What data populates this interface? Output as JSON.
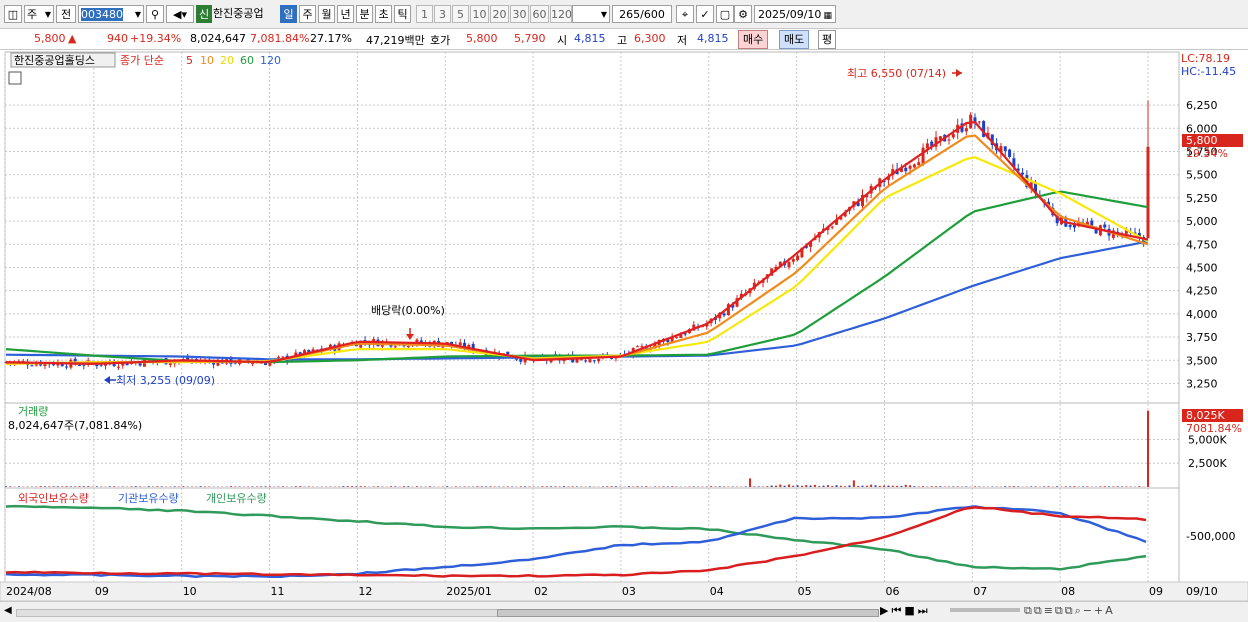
{
  "toolbar": {
    "market": "주",
    "prev": "전",
    "code": "003480",
    "new_badge": "신",
    "name": "한진중공업",
    "periods": [
      "일",
      "주",
      "월",
      "년",
      "분",
      "초",
      "틱"
    ],
    "period_active": "일",
    "intervals": [
      "1",
      "3",
      "5",
      "10",
      "20",
      "30",
      "60",
      "120"
    ],
    "count_value": "265",
    "count_total": "/600",
    "date": "2025/09/10"
  },
  "quote": {
    "price": "5,800",
    "up_arrow": "▲",
    "change": "940",
    "change_pct": "+19.34%",
    "volume": "8,024,647",
    "volume_ratio": "7,081.84%",
    "turnover": "27.17%",
    "amount": "47,219백만",
    "ask_label": "호가",
    "ask": "5,800",
    "bid": "5,790",
    "open_label": "시",
    "open": "4,815",
    "high_label": "고",
    "high": "6,300",
    "low_label": "저",
    "low": "4,815",
    "buy_label": "매수",
    "sell_label": "매도",
    "avg_label": "평"
  },
  "colors": {
    "up": "#d9261c",
    "down": "#1e40c8",
    "ma5": "#e02020",
    "ma10": "#f08a1c",
    "ma20": "#f7e80a",
    "ma60": "#1e9e3a",
    "ma120": "#2f5fd8",
    "foreign": "#d81e1e",
    "institution": "#2f5fd8",
    "individual": "#2f9a5a"
  },
  "price_panel": {
    "title": "한진중공업홀딩스",
    "legend_prefix": "종가 단순",
    "ma_labels": [
      "5",
      "10",
      "20",
      "60",
      "120"
    ],
    "lc": "LC:78.19",
    "hc": "HC:-11.45",
    "last_price": "5,800",
    "last_pct": "19.34%",
    "high_note": "최고 6,550 (07/14)",
    "low_note": "최저 3,255 (09/09)",
    "dividend_note": "배당락(0.00%)"
  },
  "volume_panel": {
    "title": "거래량",
    "summary": "8,024,647주(7,081.84%)",
    "last": "8,025K",
    "last_pct": "7081.84%"
  },
  "holding_panel": {
    "legend": [
      "외국인보유수량",
      "기관보유수량",
      "개인보유수량"
    ],
    "ytick": "-500,000"
  },
  "xaxis": {
    "labels": [
      "2024/08",
      "09",
      "10",
      "11",
      "12",
      "2025/01",
      "02",
      "03",
      "04",
      "05",
      "06",
      "07",
      "08",
      "09"
    ],
    "current": "09/10"
  },
  "chart_data": [
    {
      "type": "line",
      "title": "한진중공업홀딩스",
      "subtitle": "종가 단순 5 10 20 60 120",
      "x": [
        "2024/08",
        "09",
        "10",
        "11",
        "12",
        "2025/01",
        "02",
        "03",
        "04",
        "05",
        "06",
        "07",
        "08",
        "09"
      ],
      "yticks": [
        "3,250",
        "3,500",
        "3,750",
        "4,000",
        "4,250",
        "4,500",
        "4,750",
        "5,000",
        "5,250",
        "5,500",
        "5,750",
        "6,000",
        "6,250"
      ],
      "ylim": [
        3050,
        6650
      ],
      "series": [
        {
          "name": "5",
          "values": [
            3480,
            3460,
            3500,
            3480,
            3700,
            3680,
            3500,
            3540,
            3900,
            4650,
            5450,
            6100,
            5000,
            4800
          ]
        },
        {
          "name": "10",
          "values": [
            3470,
            3470,
            3490,
            3480,
            3680,
            3660,
            3510,
            3540,
            3800,
            4450,
            5350,
            5950,
            5050,
            4750
          ]
        },
        {
          "name": "20",
          "values": [
            3460,
            3480,
            3480,
            3490,
            3620,
            3620,
            3520,
            3550,
            3700,
            4300,
            5250,
            5700,
            5300,
            4780
          ]
        },
        {
          "name": "60",
          "values": [
            3620,
            3550,
            3490,
            3480,
            3500,
            3540,
            3550,
            3550,
            3560,
            3780,
            4400,
            5100,
            5320,
            5150
          ]
        },
        {
          "name": "120",
          "values": [
            3560,
            3550,
            3540,
            3510,
            3510,
            3520,
            3530,
            3540,
            3550,
            3660,
            3950,
            4300,
            4600,
            4780
          ]
        }
      ],
      "annotations": [
        "최고 6,550 (07/14)",
        "최저 3,255 (09/09)",
        "배당락(0.00%)"
      ]
    },
    {
      "type": "bar",
      "title": "거래량",
      "yticks": [
        "2,500K",
        "5,000K"
      ],
      "last_value": "8,025K"
    },
    {
      "type": "line",
      "title": "외국인보유수량 · 기관보유수량 · 개인보유수량",
      "yticks": [
        "-500,000"
      ]
    }
  ]
}
